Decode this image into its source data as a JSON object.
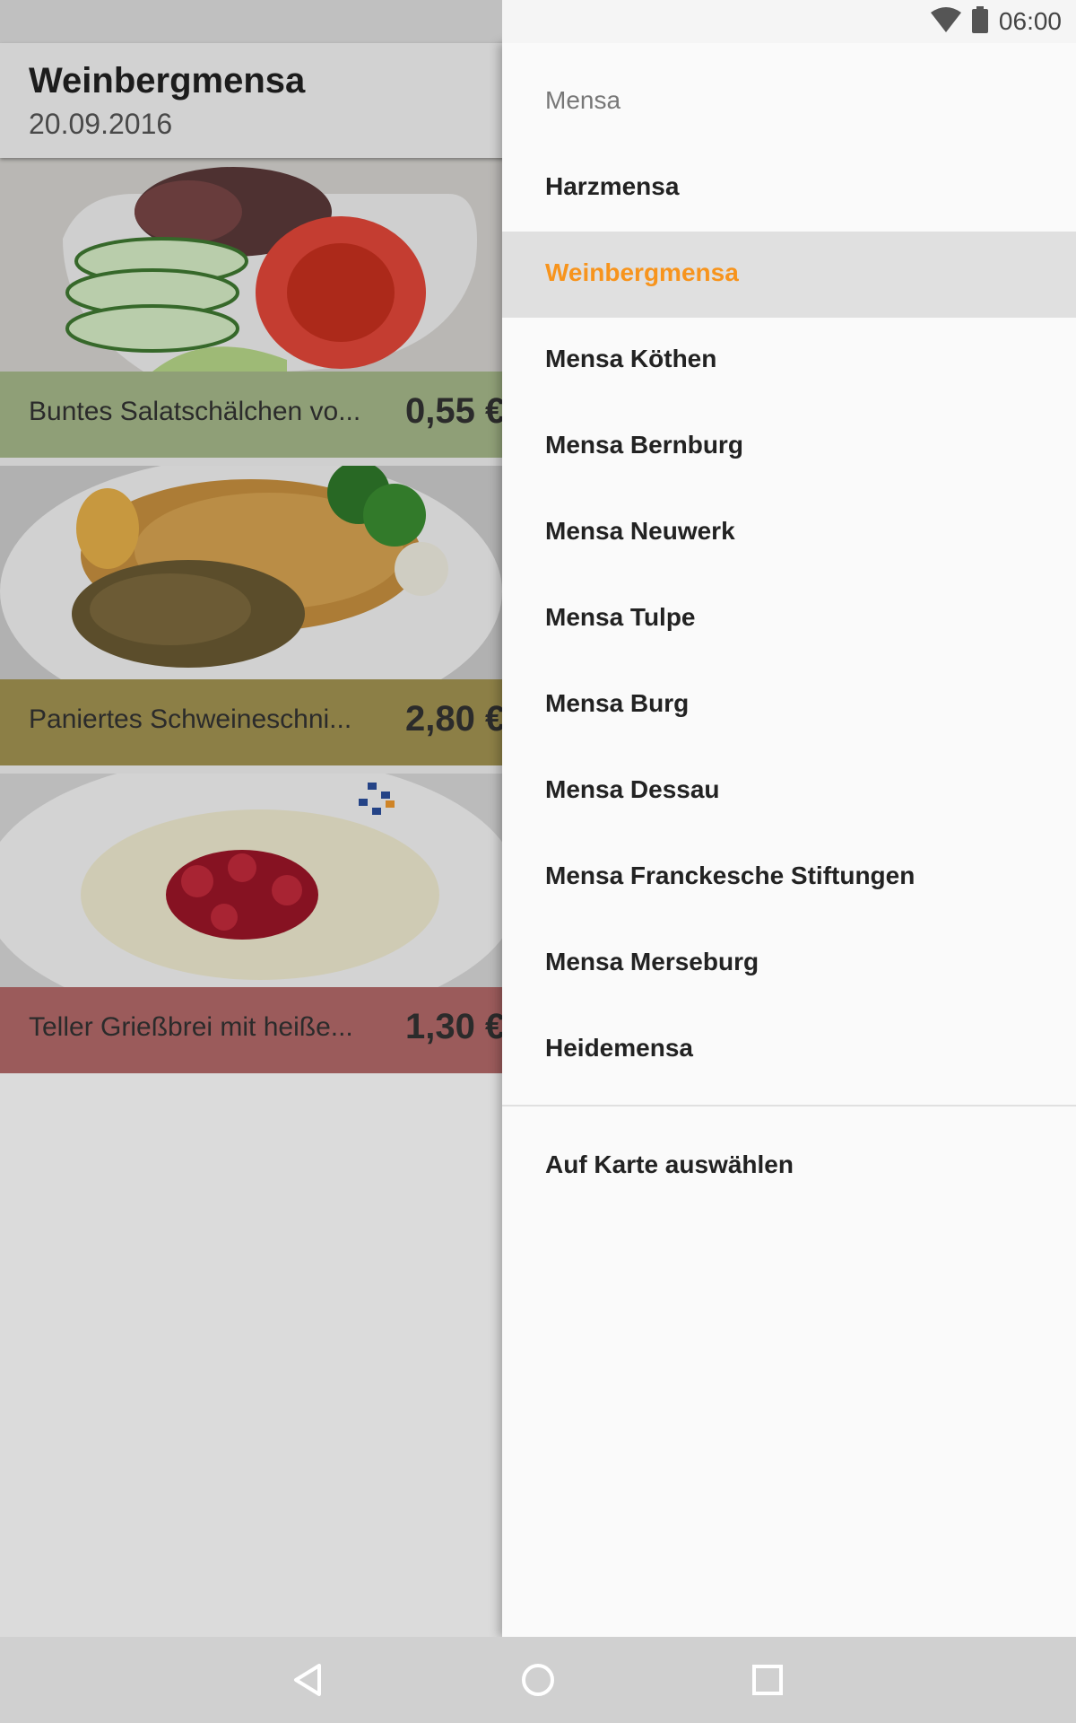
{
  "status_bar": {
    "time": "06:00"
  },
  "toolbar": {
    "title": "Weinbergmensa",
    "subtitle": "20.09.2016"
  },
  "meals": [
    {
      "name": "Buntes Salatschälchen vo...",
      "price": "0,55 €",
      "color": "#a7ba8b"
    },
    {
      "name": "Paniertes Schweineschni...",
      "price": "2,80 €",
      "color": "#a49452"
    },
    {
      "name": "Teller Grießbrei mit heiße...",
      "price": "1,30 €",
      "color": "#b56b6b"
    }
  ],
  "drawer": {
    "header": "Mensa",
    "items": [
      {
        "label": "Harzmensa"
      },
      {
        "label": "Weinbergmensa",
        "selected": true
      },
      {
        "label": "Mensa Köthen"
      },
      {
        "label": "Mensa Bernburg"
      },
      {
        "label": "Mensa Neuwerk"
      },
      {
        "label": "Mensa Tulpe"
      },
      {
        "label": "Mensa Burg"
      },
      {
        "label": "Mensa Dessau"
      },
      {
        "label": "Mensa Franckesche Stiftungen"
      },
      {
        "label": "Mensa Merseburg"
      },
      {
        "label": "Heidemensa"
      }
    ],
    "map_item": "Auf Karte auswählen",
    "accent_color": "#f7941d"
  },
  "icons": {
    "wifi": "wifi-icon",
    "battery": "battery-icon",
    "back": "back-icon",
    "home": "home-icon",
    "recent": "recent-apps-icon"
  }
}
